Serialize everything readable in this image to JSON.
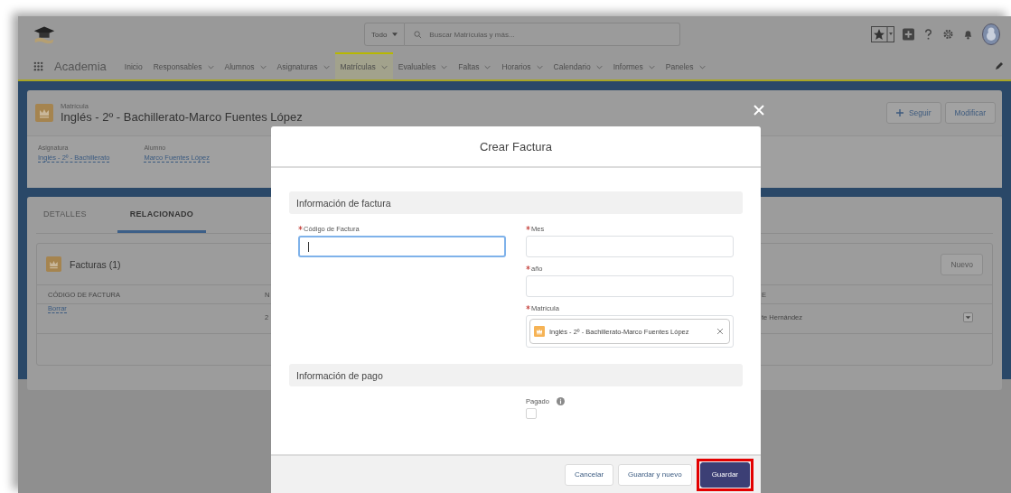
{
  "app": {
    "name": "Academia"
  },
  "search": {
    "scope": "Todo",
    "placeholder": "Buscar Matrículas y más..."
  },
  "nav": [
    {
      "label": "Inicio",
      "dropdown": false,
      "selected": false
    },
    {
      "label": "Responsables",
      "dropdown": true,
      "selected": false
    },
    {
      "label": "Alumnos",
      "dropdown": true,
      "selected": false
    },
    {
      "label": "Asignaturas",
      "dropdown": true,
      "selected": false
    },
    {
      "label": "Matrículas",
      "dropdown": true,
      "selected": true
    },
    {
      "label": "Evaluables",
      "dropdown": true,
      "selected": false
    },
    {
      "label": "Faltas",
      "dropdown": true,
      "selected": false
    },
    {
      "label": "Horarios",
      "dropdown": true,
      "selected": false
    },
    {
      "label": "Calendario",
      "dropdown": true,
      "selected": false
    },
    {
      "label": "Informes",
      "dropdown": true,
      "selected": false
    },
    {
      "label": "Paneles",
      "dropdown": true,
      "selected": false
    }
  ],
  "record": {
    "type": "Matrícula",
    "title": "Inglés - 2º - Bachillerato-Marco Fuentes López",
    "actions": [
      {
        "label": "Seguir",
        "kind": "follow"
      },
      {
        "label": "Modificar",
        "kind": "plain"
      }
    ],
    "fields": [
      {
        "label": "Asignatura",
        "value": "Inglés - 2º - Bachillerato"
      },
      {
        "label": "Alumno",
        "value": "Marco Fuentes López"
      }
    ]
  },
  "tabs": [
    {
      "label": "DETALLES",
      "selected": false
    },
    {
      "label": "RELACIONADO",
      "selected": true
    }
  ],
  "related": {
    "title": "Facturas (1)",
    "button": "Nuevo",
    "columns": [
      "CÓDIGO DE FACTURA",
      "N",
      "E"
    ],
    "rows": [
      [
        "Borrar",
        "2",
        "te Hernández"
      ]
    ]
  },
  "modal": {
    "title": "Crear Factura",
    "sections": [
      {
        "title": "Información de factura",
        "left": [
          {
            "kind": "text",
            "label": "Código de Factura",
            "required": true,
            "focused": true
          }
        ],
        "right": [
          {
            "kind": "text",
            "label": "Mes",
            "required": true,
            "focused": false
          },
          {
            "kind": "text",
            "label": "año",
            "required": true,
            "focused": false
          },
          {
            "kind": "lookup",
            "label": "Matrícula",
            "required": true,
            "value": "Inglés - 2º - Bachillerato-Marco Fuentes López"
          }
        ]
      },
      {
        "title": "Información de pago",
        "right": [
          {
            "kind": "checkbox",
            "label": "Pagado",
            "required": false,
            "checked": false,
            "info": true
          }
        ]
      }
    ],
    "buttons": [
      {
        "label": "Cancelar",
        "kind": "neutral",
        "highlighted": false
      },
      {
        "label": "Guardar y nuevo",
        "kind": "neutral",
        "highlighted": false
      },
      {
        "label": "Guardar",
        "kind": "brand",
        "highlighted": true
      }
    ]
  }
}
